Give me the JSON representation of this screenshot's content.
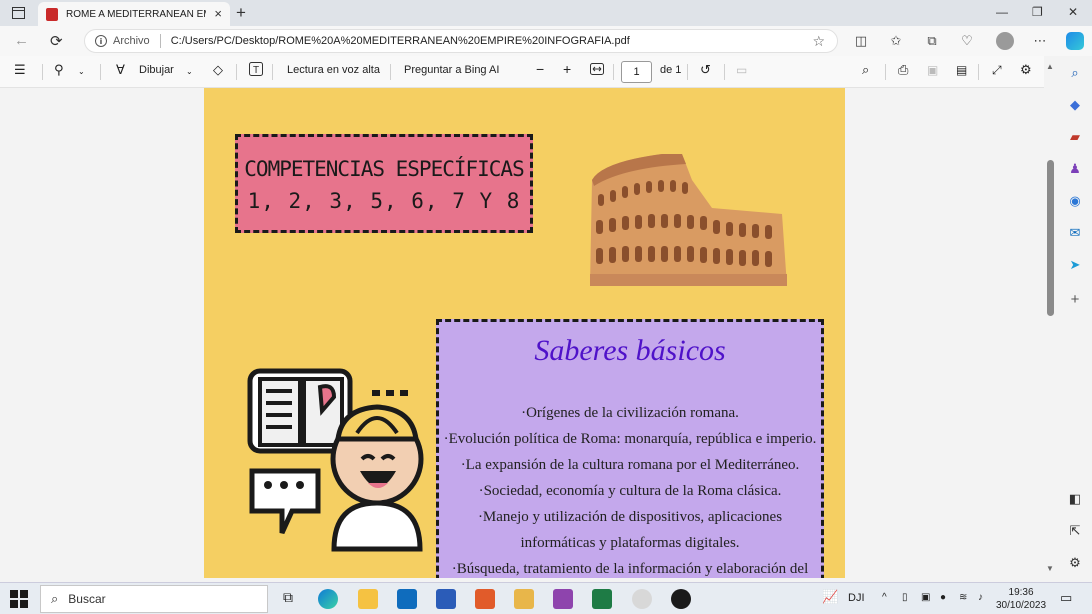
{
  "browser": {
    "tab_title": "ROME A MEDITERRANEAN EMPIRE",
    "address_prefix": "Archivo",
    "url": "C:/Users/PC/Desktop/ROME%20A%20MEDITERRANEAN%20EMPIRE%20INFOGRAFIA.pdf"
  },
  "pdf_toolbar": {
    "draw_label": "Dibujar",
    "read_aloud_label": "Lectura en voz alta",
    "ask_bing_label": "Preguntar a Bing AI",
    "page_current": "1",
    "page_total": "de 1"
  },
  "document": {
    "competencias_title": "COMPETENCIAS ESPECÍFICAS",
    "competencias_numbers": "1, 2, 3, 5, 6, 7 Y 8",
    "saberes_title": "Saberes básicos",
    "saberes_items": [
      "·Orígenes de la civilización romana.",
      "·Evolución política de Roma: monarquía, república e imperio.",
      "·La expansión de la cultura romana por el Mediterráneo.",
      "·Sociedad, economía y cultura de la Roma clásica.",
      "·Manejo y utilización de dispositivos, aplicaciones informáticas y plataformas digitales.",
      "·Búsqueda, tratamiento de la información y elaboración del"
    ]
  },
  "taskbar": {
    "search_placeholder": "Buscar",
    "tray_label": "DJI",
    "time": "19:36",
    "date": "30/10/2023"
  },
  "colors": {
    "page_bg": "#f5cf62",
    "competencias_bg": "#e7748c",
    "saberes_bg": "#c4a8ec",
    "saberes_title": "#4f12c9"
  }
}
